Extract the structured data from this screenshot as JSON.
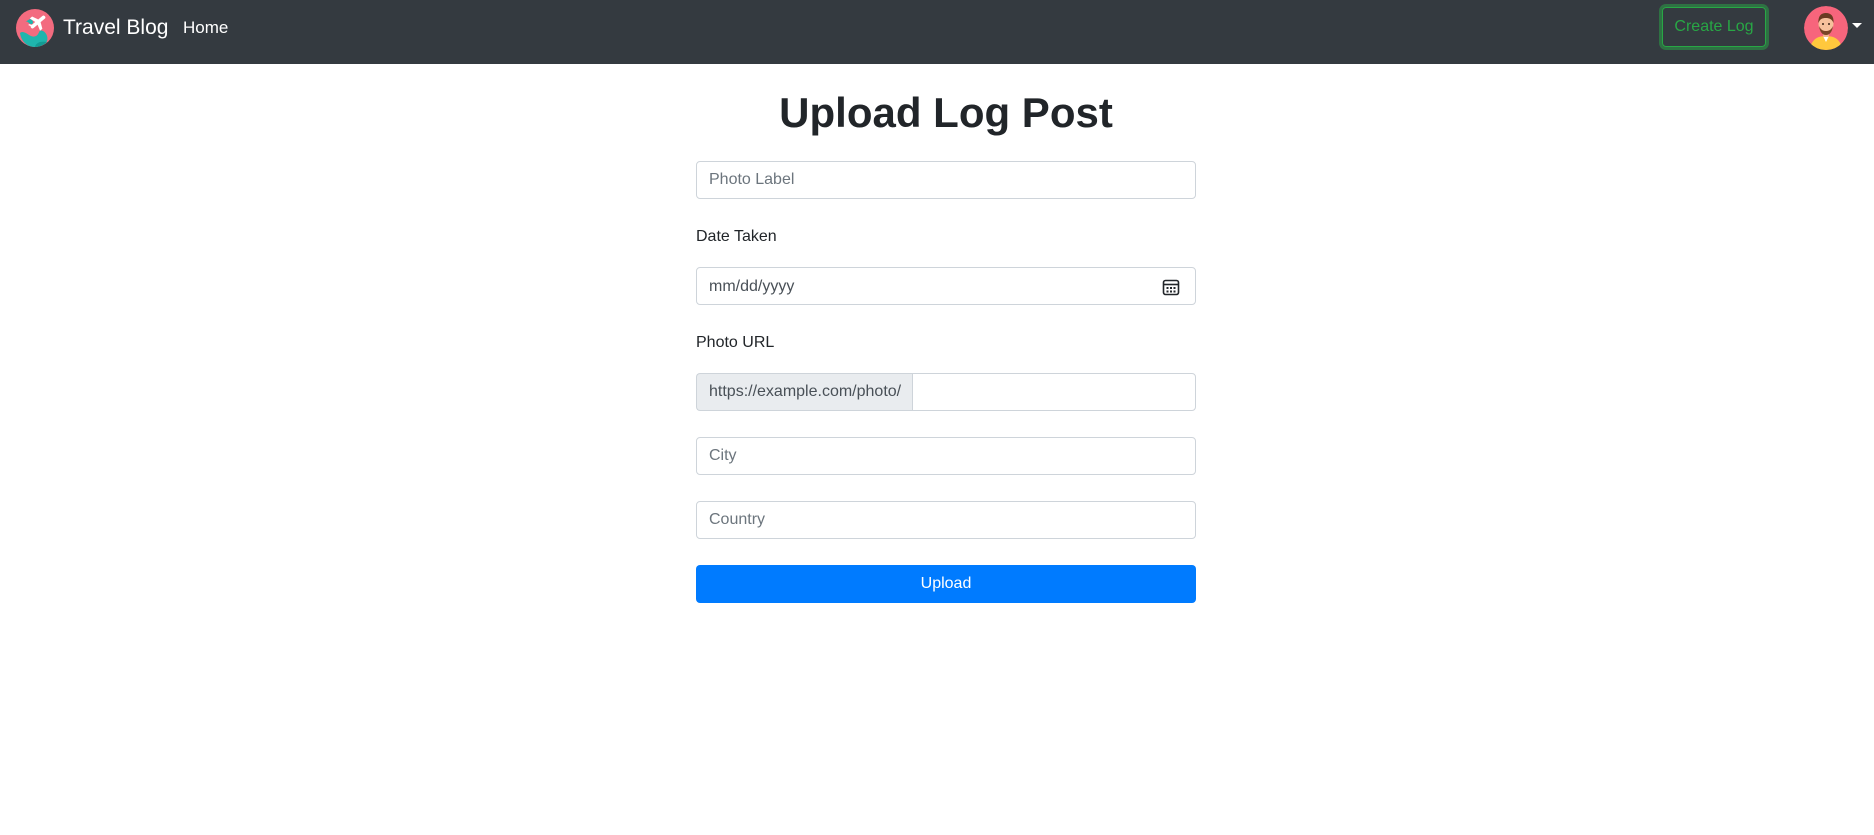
{
  "navbar": {
    "brand_name": "Travel Blog",
    "home_link": "Home",
    "create_log_button": "Create Log",
    "bg_color": "#343a40"
  },
  "page": {
    "title": "Upload Log Post"
  },
  "form": {
    "photo_label_placeholder": "Photo Label",
    "date_taken_label": "Date Taken",
    "date_placeholder": "mm/dd/yyyy",
    "photo_url_label": "Photo URL",
    "photo_url_prefix": "https://example.com/photo/",
    "photo_url_value": "",
    "city_placeholder": "City",
    "country_placeholder": "Country",
    "upload_button": "Upload"
  },
  "colors": {
    "primary": "#007bff",
    "success": "#28a745",
    "input_border": "#ced4da",
    "addon_bg": "#e9ecef"
  },
  "icons": {
    "brand": "travel-globe-plane-icon",
    "calendar": "calendar-icon",
    "avatar": "user-avatar",
    "caret": "caret-down-icon"
  }
}
